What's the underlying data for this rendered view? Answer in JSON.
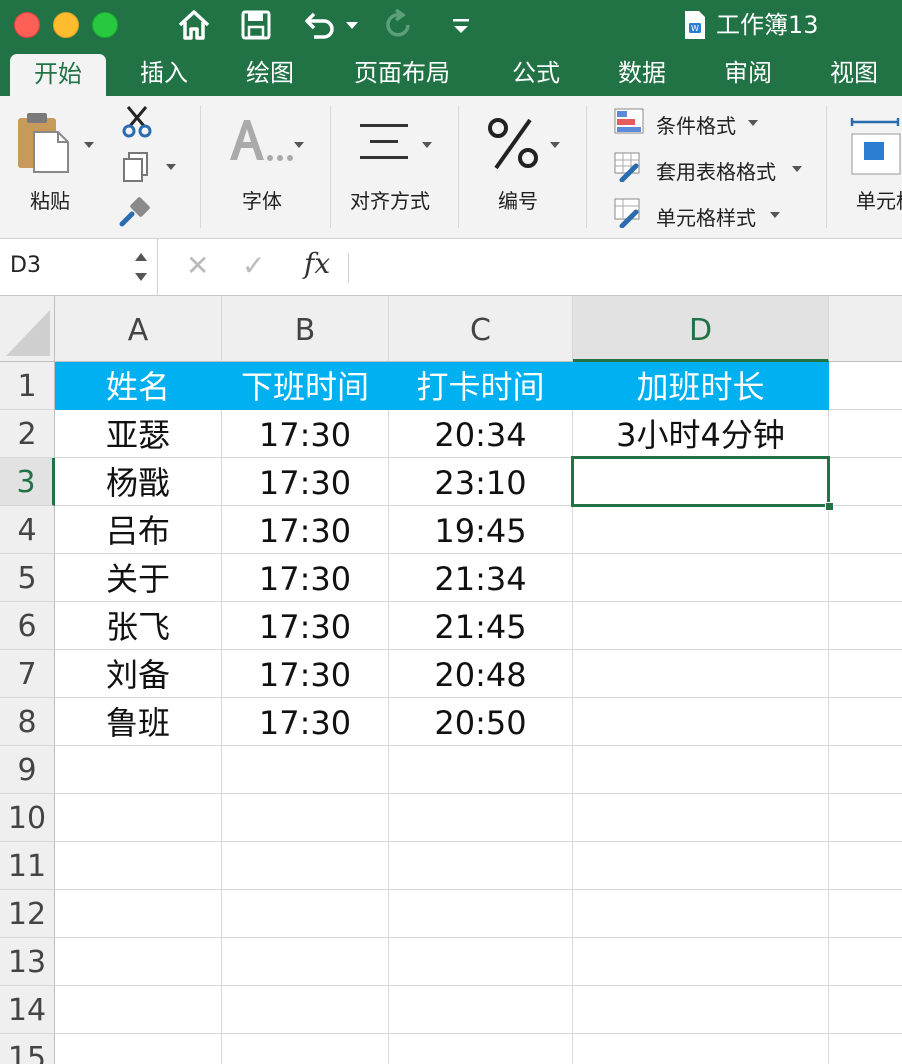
{
  "titlebar": {
    "doc_title": "工作簿13",
    "colors": {
      "accent": "#217346"
    }
  },
  "tabs": [
    "开始",
    "插入",
    "绘图",
    "页面布局",
    "公式",
    "数据",
    "审阅",
    "视图"
  ],
  "ribbon": {
    "paste_label": "粘贴",
    "font_label": "字体",
    "align_label": "对齐方式",
    "number_label": "编号",
    "conditional_format": "条件格式",
    "table_format": "套用表格格式",
    "cell_style": "单元格样式",
    "cells_label": "单元格"
  },
  "formula_bar": {
    "name_box": "D3",
    "fx": "fx",
    "formula": ""
  },
  "sheet": {
    "columns": [
      "A",
      "B",
      "C",
      "D"
    ],
    "rows": [
      "1",
      "2",
      "3",
      "4",
      "5",
      "6",
      "7",
      "8",
      "9",
      "10",
      "11",
      "12",
      "13",
      "14",
      "15"
    ],
    "header_row": [
      "姓名",
      "下班时间",
      "打卡时间",
      "加班时长"
    ],
    "data": [
      [
        "亚瑟",
        "17:30",
        "20:34",
        "3小时4分钟"
      ],
      [
        "杨戬",
        "17:30",
        "23:10",
        ""
      ],
      [
        "吕布",
        "17:30",
        "19:45",
        ""
      ],
      [
        "关于",
        "17:30",
        "21:34",
        ""
      ],
      [
        "张飞",
        "17:30",
        "21:45",
        ""
      ],
      [
        "刘备",
        "17:30",
        "20:48",
        ""
      ],
      [
        "鲁班",
        "17:30",
        "20:50",
        ""
      ]
    ],
    "selected_cell": "D3",
    "header_fill": "#00b0f0"
  }
}
